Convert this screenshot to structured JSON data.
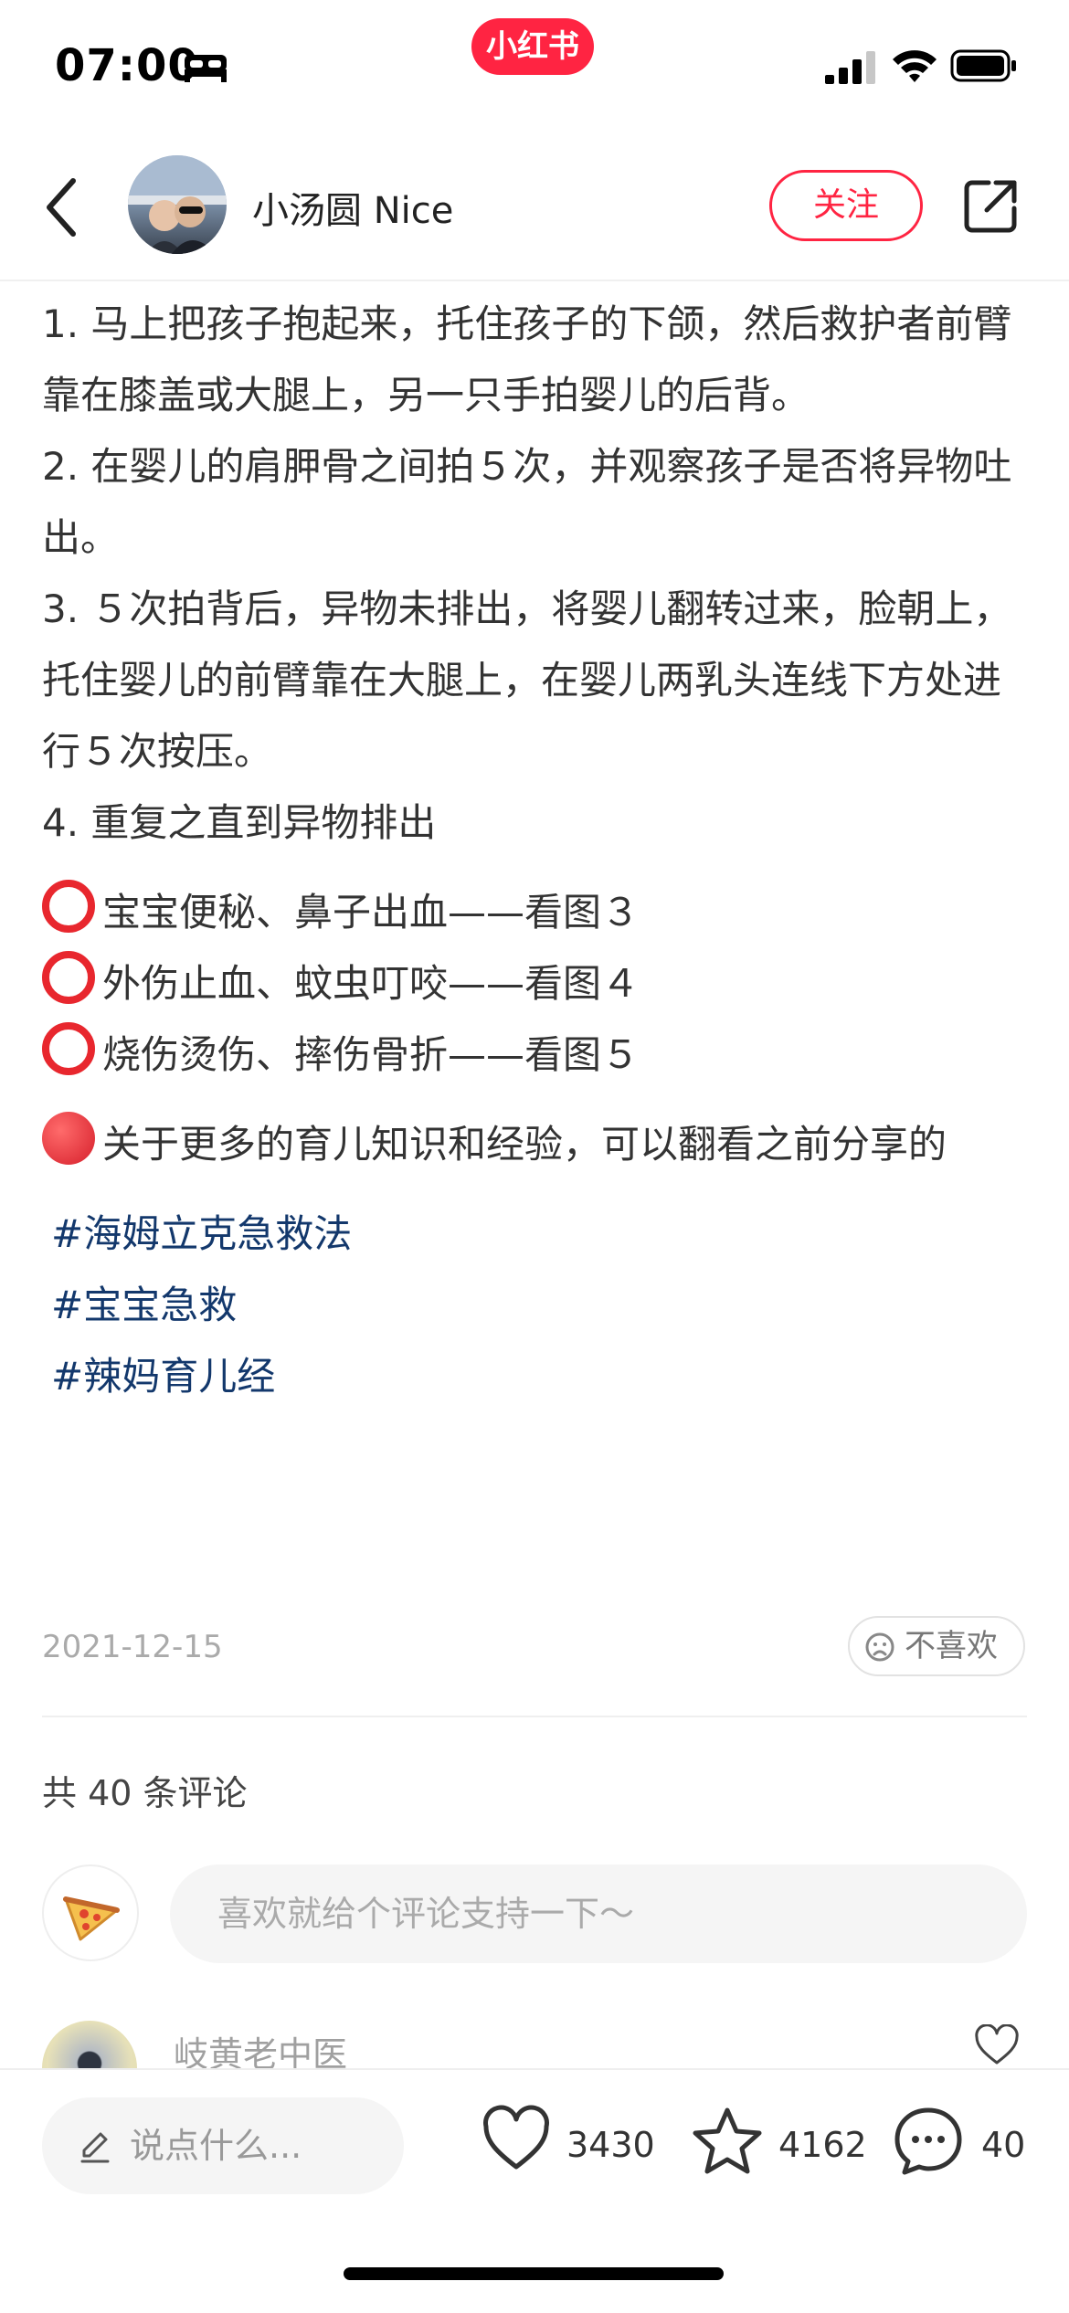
{
  "status_bar": {
    "time": "07:00",
    "app_badge": "小红书"
  },
  "header": {
    "author_name": "小汤圆 Nice",
    "follow_label": "关注"
  },
  "content": {
    "steps": [
      "1. 马上把孩子抱起来，托住孩子的下颌，然后救护者前臂靠在膝盖或大腿上，另一只手拍婴儿的后背。",
      "2. 在婴儿的肩胛骨之间拍５次，并观察孩子是否将异物吐出。",
      "3. ５次拍背后，异物未排出，将婴儿翻转过来，脸朝上，托住婴儿的前臂靠在大腿上，在婴儿两乳头连线下方处进行５次按压。",
      "4. 重复之直到异物排出"
    ],
    "bullets": [
      "宝宝便秘、鼻子出血——看图３",
      "外伤止血、蚊虫叮咬——看图４",
      "烧伤烫伤、摔伤骨折——看图５"
    ],
    "note": "关于更多的育儿知识和经验，可以翻看之前分享的",
    "tags": [
      "#海姆立克急救法",
      "#宝宝急救",
      "#辣妈育儿经"
    ]
  },
  "meta": {
    "date": "2021-12-15",
    "dislike_label": "不喜欢"
  },
  "comments": {
    "count_label": "共 40 条评论",
    "input_placeholder": "喜欢就给个评论支持一下～",
    "first_commenter": "岐黄老中医"
  },
  "bottom_bar": {
    "input_placeholder": "说点什么...",
    "likes": "3430",
    "collects": "4162",
    "comments": "40"
  },
  "colors": {
    "brand": "#ff2442",
    "tag": "#13386c"
  },
  "icons": [
    "back-icon",
    "share-icon",
    "sleep-icon",
    "signal-icon",
    "wifi-icon",
    "battery-icon",
    "sad-face-icon",
    "pizza-icon",
    "heart-icon",
    "star-icon",
    "comment-icon",
    "pen-icon"
  ]
}
